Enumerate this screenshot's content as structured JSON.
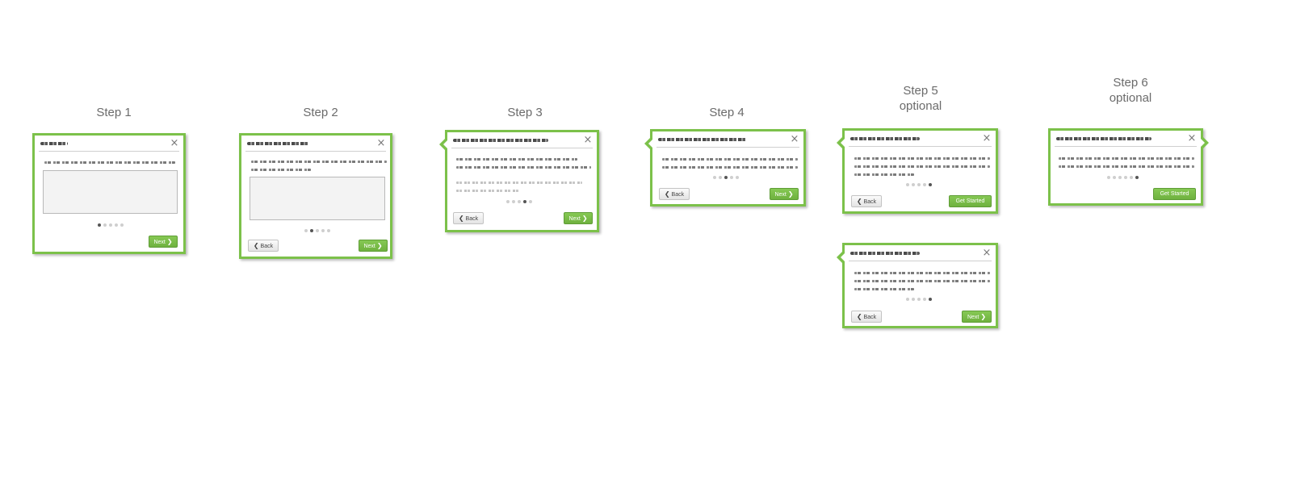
{
  "steps": [
    {
      "label": "Step 1",
      "sub": ""
    },
    {
      "label": "Step 2",
      "sub": ""
    },
    {
      "label": "Step 3",
      "sub": ""
    },
    {
      "label": "Step 4",
      "sub": ""
    },
    {
      "label": "Step 5",
      "sub": "optional"
    },
    {
      "label": "Step 6",
      "sub": "optional"
    }
  ],
  "buttons": {
    "next": "Next",
    "back": "Back",
    "get_started": "Get Started"
  },
  "icons": {
    "close": "×",
    "chevron_left": "❮",
    "chevron_right": "❯"
  },
  "colors": {
    "accent_green": "#7cc14a",
    "button_green": "#6fb13f",
    "label_gray": "#6b6b6b"
  },
  "pagination": {
    "step1_active": 1,
    "step2_active": 2,
    "step3_active": 4,
    "step4_active": 3,
    "step5_active": 5,
    "step5b_active": 5,
    "step6_active": 6,
    "total": 5
  }
}
